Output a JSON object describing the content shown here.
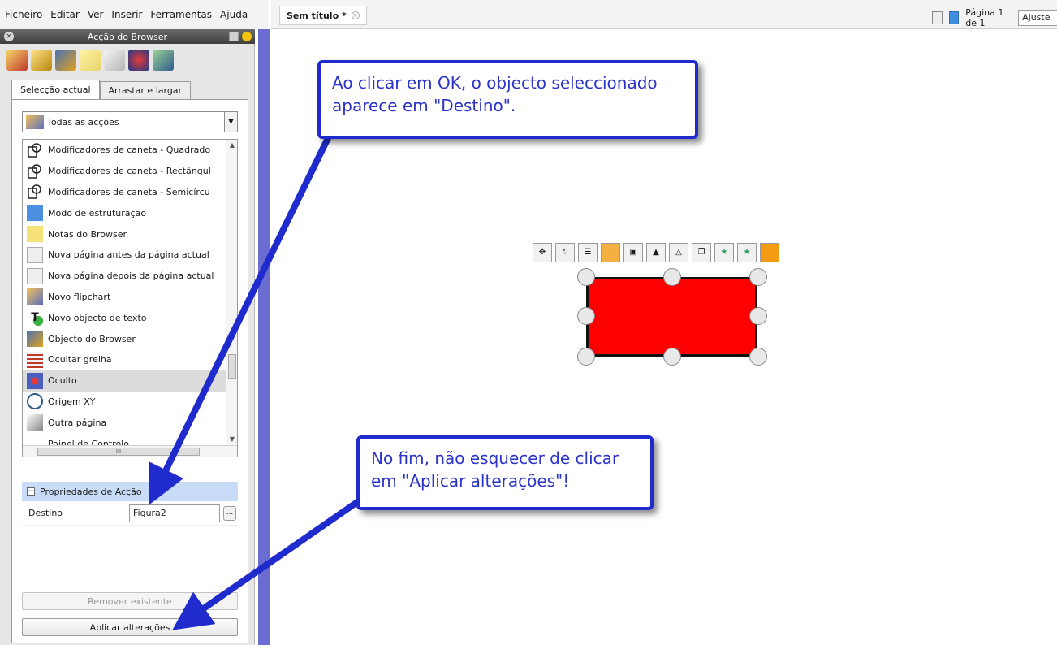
{
  "menu": [
    "Ficheiro",
    "Editar",
    "Ver",
    "Inserir",
    "Ferramentas",
    "Ajuda"
  ],
  "panel": {
    "title": "Acção do Browser",
    "tabs": [
      "Selecção actual",
      "Arrastar e largar"
    ],
    "dropdown_value": "Todas as acções",
    "list_items": [
      "Modificadores de caneta - Quadrado",
      "Modificadores de caneta - Rectângul",
      "Modificadores de caneta - Semicírcu",
      "Modo de estruturação",
      "Notas do Browser",
      "Nova página antes da página actual",
      "Nova página depois da página actual",
      "Novo flipchart",
      "Novo objecto de texto",
      "Objecto do Browser",
      "Ocultar grelha",
      "Oculto",
      "Origem XY",
      "Outra página",
      "Painel de Controlo"
    ],
    "selected_item": "Oculto",
    "hscroll_label": "III",
    "properties": {
      "header": "Propriedades de Acção",
      "field_label": "Destino",
      "field_value": "Figura2",
      "browse_label": "..."
    },
    "remove_button": "Remover existente",
    "apply_button": "Aplicar alterações"
  },
  "document": {
    "tab_title": "Sem título *",
    "page_indicator": "Página 1 de 1",
    "zoom": "Ajuste auto"
  },
  "callouts": {
    "top": [
      "Ao clicar em OK, o objecto seleccionado",
      "aparece em \"Destino\"."
    ],
    "bottom": [
      "No fim, não esquecer de clicar",
      "em \"Aplicar alterações\"!"
    ]
  },
  "colors": {
    "accent_blue": "#1f2bcc",
    "shape_fill": "#ff0000",
    "divider": "#6a6cd2"
  }
}
